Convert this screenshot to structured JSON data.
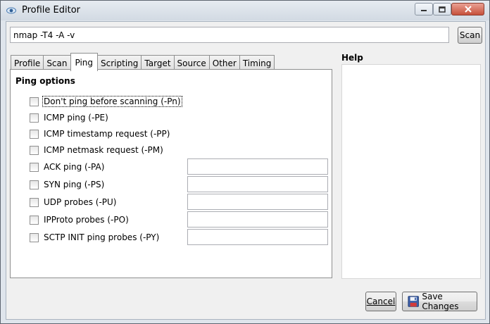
{
  "window": {
    "title": "Profile Editor",
    "icon": "eye-icon",
    "controls": [
      "minimize-icon",
      "maximize-icon",
      "close-icon"
    ]
  },
  "command": {
    "value": "nmap -T4 -A -v",
    "scan_label": "Scan"
  },
  "tabs": [
    {
      "label": "Profile"
    },
    {
      "label": "Scan"
    },
    {
      "label": "Ping",
      "active": true
    },
    {
      "label": "Scripting"
    },
    {
      "label": "Target"
    },
    {
      "label": "Source"
    },
    {
      "label": "Other"
    },
    {
      "label": "Timing"
    }
  ],
  "ping": {
    "section_title": "Ping options",
    "options": [
      {
        "label": "Don't ping before scanning (-Pn)",
        "checked": false,
        "focused": true
      },
      {
        "label": "ICMP ping (-PE)",
        "checked": false
      },
      {
        "label": "ICMP timestamp request (-PP)",
        "checked": false
      },
      {
        "label": "ICMP netmask request (-PM)",
        "checked": false
      },
      {
        "label": "ACK ping (-PA)",
        "checked": false,
        "has_input": true
      },
      {
        "label": "SYN ping (-PS)",
        "checked": false,
        "has_input": true
      },
      {
        "label": "UDP probes (-PU)",
        "checked": false,
        "has_input": true
      },
      {
        "label": "IPProto probes (-PO)",
        "checked": false,
        "has_input": true
      },
      {
        "label": "SCTP INIT ping probes (-PY)",
        "checked": false,
        "has_input": true
      }
    ]
  },
  "help": {
    "label": "Help",
    "content": ""
  },
  "footer": {
    "cancel_label": "Cancel",
    "save_label": "Save Changes",
    "save_icon": "floppy-disk-icon"
  }
}
